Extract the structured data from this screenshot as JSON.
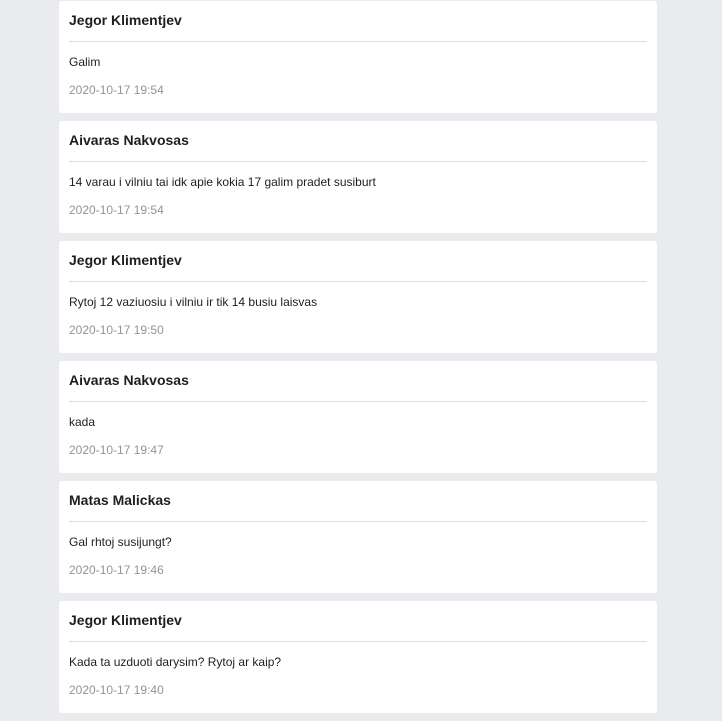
{
  "messages": [
    {
      "author": "Jegor Klimentjev",
      "text": "Galim",
      "timestamp": "2020-10-17 19:54"
    },
    {
      "author": "Aivaras Nakvosas",
      "text": "14 varau i vilniu tai idk apie kokia 17 galim pradet susiburt",
      "timestamp": "2020-10-17 19:54"
    },
    {
      "author": "Jegor Klimentjev",
      "text": "Rytoj 12 vaziuosiu i vilniu ir tik 14 busiu laisvas",
      "timestamp": "2020-10-17 19:50"
    },
    {
      "author": "Aivaras Nakvosas",
      "text": "kada",
      "timestamp": "2020-10-17 19:47"
    },
    {
      "author": "Matas Malickas",
      "text": "Gal rhtoj susijungt?",
      "timestamp": "2020-10-17 19:46"
    },
    {
      "author": "Jegor Klimentjev",
      "text": "Kada ta uzduoti darysim? Rytoj ar kaip?",
      "timestamp": "2020-10-17 19:40"
    }
  ]
}
